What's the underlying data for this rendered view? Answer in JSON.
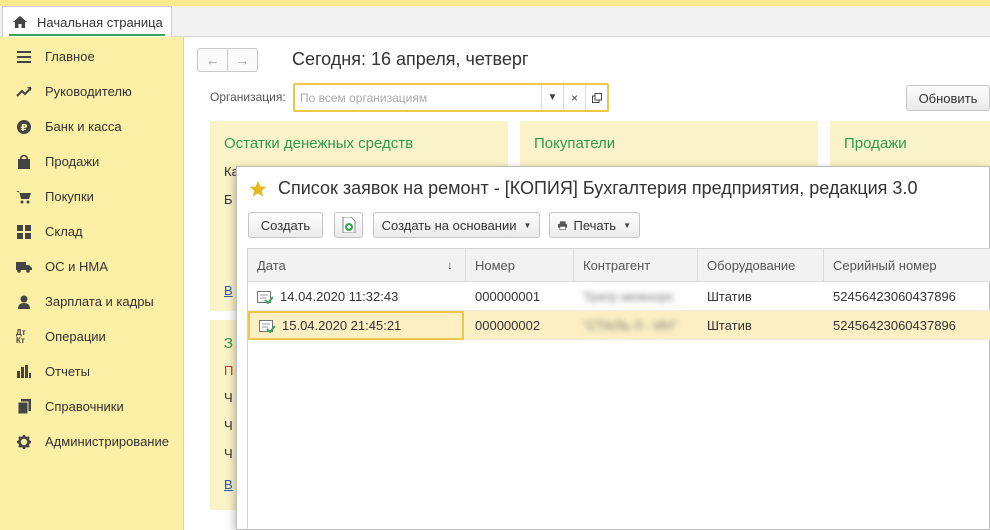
{
  "tabs": {
    "home_label": "Начальная страница"
  },
  "sidebar": {
    "items": [
      {
        "label": "Главное",
        "icon": "menu-lines-icon"
      },
      {
        "label": "Руководителю",
        "icon": "trend-up-icon"
      },
      {
        "label": "Банк и касса",
        "icon": "ruble-coin-icon"
      },
      {
        "label": "Продажи",
        "icon": "shopping-bag-icon"
      },
      {
        "label": "Покупки",
        "icon": "shopping-cart-icon"
      },
      {
        "label": "Склад",
        "icon": "warehouse-grid-icon"
      },
      {
        "label": "ОС и НМА",
        "icon": "truck-icon"
      },
      {
        "label": "Зарплата и кадры",
        "icon": "person-icon"
      },
      {
        "label": "Операции",
        "icon": "dt-kt-icon"
      },
      {
        "label": "Отчеты",
        "icon": "bar-chart-icon"
      },
      {
        "label": "Справочники",
        "icon": "book-icon"
      },
      {
        "label": "Администрирование",
        "icon": "gear-icon"
      }
    ],
    "operations_glyph": "Дт Кт"
  },
  "main": {
    "today": "Сегодня: 16 апреля, четверг",
    "org_label": "Организация:",
    "org_placeholder": "По всем организациям",
    "refresh_label": "Обновить",
    "panels": {
      "cash_title": "Остатки денежных средств",
      "buyers_title": "Покупатели",
      "sales_title": "Продажи"
    },
    "cut_text": {
      "c1": "Ка",
      "c2": "Б",
      "c3": "В",
      "c4": "З",
      "c5": "П",
      "c6": "Ч",
      "c7": "Ч",
      "c8": "Ч",
      "c9": "В"
    }
  },
  "dialog": {
    "title": "Список заявок на ремонт - [КОПИЯ] Бухгалтерия предприятия, редакция 3.0",
    "toolbar": {
      "create": "Создать",
      "create_based": "Создать на основании",
      "print": "Печать"
    },
    "columns": [
      "Дата",
      "Номер",
      "Контрагент",
      "Оборудование",
      "Серийный номер"
    ],
    "rows": [
      {
        "date": "14.04.2020 11:32:43",
        "number": "000000001",
        "contractor": "Тратр межнорс",
        "equipment": "Штатив",
        "serial": "52456423060437896"
      },
      {
        "date": "15.04.2020 21:45:21",
        "number": "000000002",
        "contractor": "\"СТАЛЬ Л - ИН\"",
        "equipment": "Штатив",
        "serial": "52456423060437896"
      }
    ]
  },
  "colors": {
    "sidebar_bg": "#fbeea5",
    "accent_green": "#2e9a4c",
    "focus_yellow": "#f0c648",
    "selected_row": "#fbefc3"
  }
}
